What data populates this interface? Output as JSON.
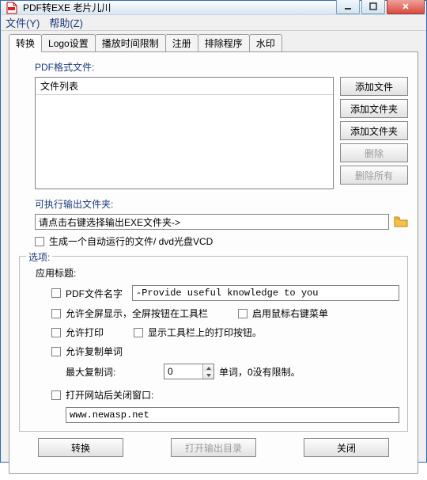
{
  "window": {
    "title": "PDF转EXE  老片儿川"
  },
  "menu": {
    "file": "文件(Y)",
    "help": "帮助(Z)"
  },
  "tabs": [
    "转换",
    "Logo设置",
    "播放时间限制",
    "注册",
    "排除程序",
    "水印"
  ],
  "pdf_section_label": "PDF格式文件:",
  "filelist_header": "文件列表",
  "side": {
    "add_file": "添加文件",
    "add_folder1": "添加文件夹",
    "add_folder2": "添加文件夹",
    "delete": "删除",
    "delete_all": "删除所有"
  },
  "outdir_label": "可执行输出文件夹:",
  "outdir_value": "请点击右键选择输出EXE文件夹->",
  "autorun_label": "生成一个自动运行的文件/ dvd光盘VCD",
  "options": {
    "legend": "选项:",
    "app_title_label": "应用标题:",
    "filename_cb": "PDF文件名字",
    "filename_value": "-Provide useful knowledge to you",
    "fullscreen_cb": "允许全屏显示，全屏按钮在工具栏",
    "rclick_cb": "启用鼠标右键菜单",
    "print_cb": "允许打印",
    "print_btn_cb": "显示工具栏上的打印按钮。",
    "copy_cb": "允许复制单词",
    "max_copy_label": "最大复制词:",
    "max_copy_value": "0",
    "max_copy_hint": "单词，0没有限制。",
    "close_after_cb": "打开网站后关闭窗口:",
    "url_value": "www.newasp.net"
  },
  "bottom": {
    "convert": "转换",
    "open_out": "打开输出目录",
    "close": "关闭"
  }
}
